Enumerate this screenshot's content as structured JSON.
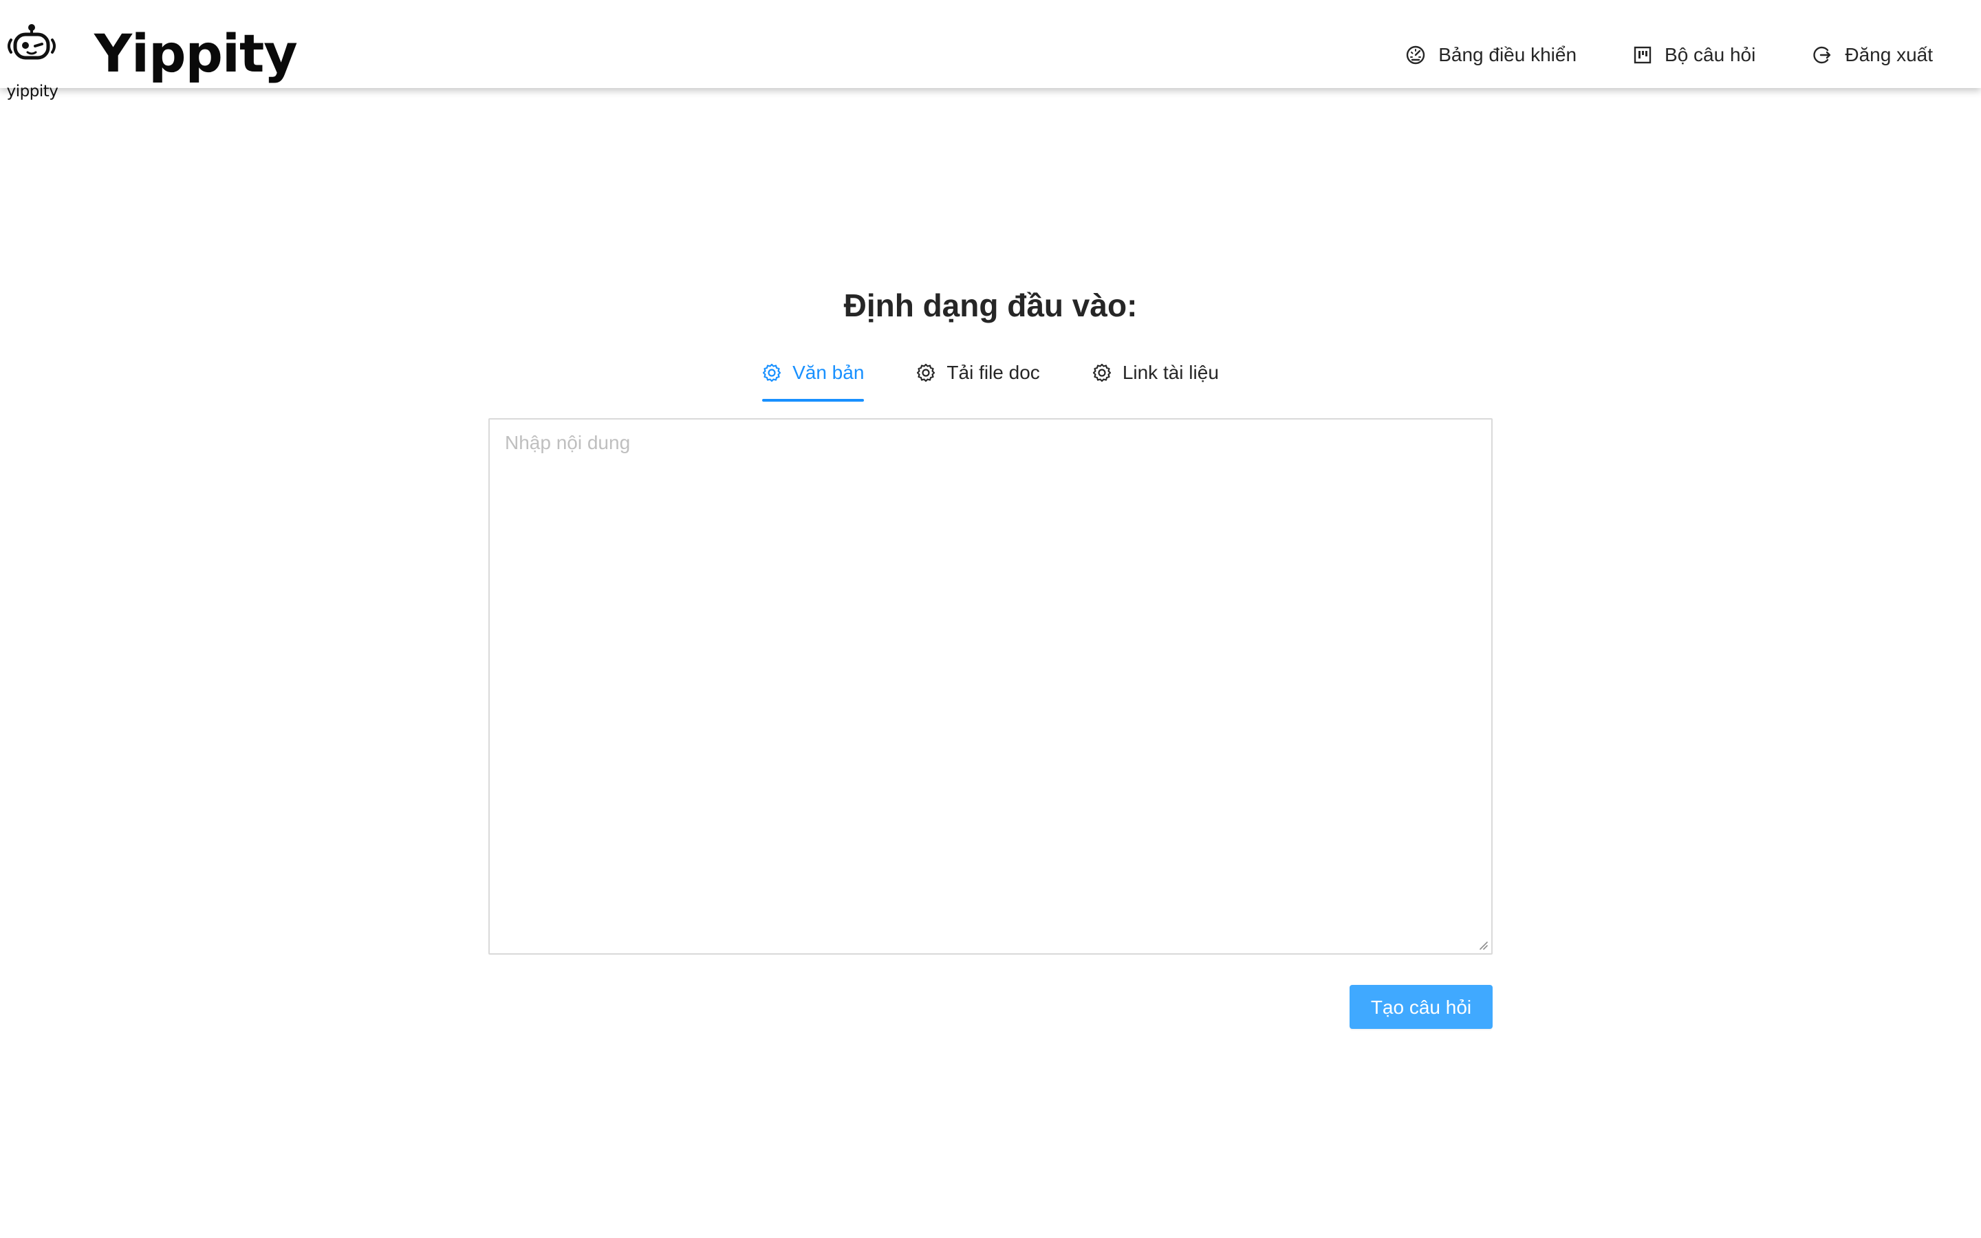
{
  "header": {
    "logo_caption": "yippity",
    "brand": "Yippity",
    "nav": [
      {
        "label": "Bảng điều khiển",
        "icon": "dashboard-icon"
      },
      {
        "label": "Bộ câu hỏi",
        "icon": "project-icon"
      },
      {
        "label": "Đăng xuất",
        "icon": "logout-icon"
      }
    ]
  },
  "main": {
    "title": "Định dạng đầu vào:",
    "tabs": [
      {
        "label": "Văn bản",
        "icon": "gear-icon",
        "active": true
      },
      {
        "label": "Tải file doc",
        "icon": "gear-icon",
        "active": false
      },
      {
        "label": "Link tài liệu",
        "icon": "gear-icon",
        "active": false
      }
    ],
    "input": {
      "placeholder": "Nhập nội dung",
      "value": ""
    },
    "submit_label": "Tạo câu hỏi"
  },
  "colors": {
    "accent": "#1890ff",
    "button": "#40a9ff",
    "text": "#262626",
    "border": "#d9d9d9",
    "placeholder": "#bfbfbf"
  }
}
